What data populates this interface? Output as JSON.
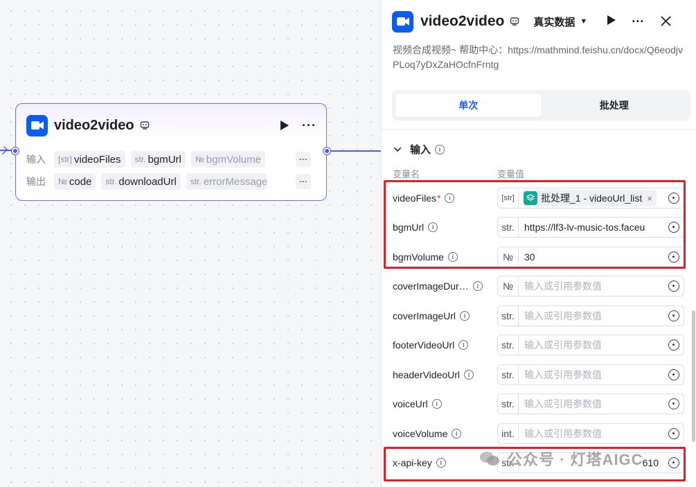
{
  "node": {
    "title": "video2video",
    "input_label": "输入",
    "output_label": "输出",
    "inputs": [
      {
        "type": "[str]",
        "name": "videoFiles"
      },
      {
        "type": "str.",
        "name": "bgmUrl"
      },
      {
        "type": "№",
        "name": "bgmVolume"
      }
    ],
    "outputs": [
      {
        "type": "№",
        "name": "code"
      },
      {
        "type": "str.",
        "name": "downloadUrl"
      },
      {
        "type": "str.",
        "name": "errorMessage"
      }
    ],
    "more": "···"
  },
  "panel": {
    "title": "video2video",
    "data_mode": "真实数据",
    "description": "视频合成视频~ 帮助中心：https://mathmind.feishu.cn/docx/Q6eodjvPLoq7yDxZaHOcfnFrntg",
    "tabs": [
      "单次",
      "批处理"
    ],
    "section_title": "输入",
    "col_name": "变量名",
    "col_value": "变量值",
    "params": [
      {
        "name": "videoFiles",
        "required": "*",
        "type": "[str]",
        "chip_text": "批处理_1 - videoUrl_list",
        "value": ""
      },
      {
        "name": "bgmUrl",
        "type": "str.",
        "value": "https://lf3-lv-music-tos.faceu"
      },
      {
        "name": "bgmVolume",
        "type": "№",
        "value": "30"
      },
      {
        "name": "coverImageDur…",
        "type": "№",
        "placeholder": "输入或引用参数值"
      },
      {
        "name": "coverImageUrl",
        "type": "str.",
        "placeholder": "输入或引用参数值"
      },
      {
        "name": "footerVideoUrl",
        "type": "str.",
        "placeholder": "输入或引用参数值"
      },
      {
        "name": "headerVideoUrl",
        "type": "str.",
        "placeholder": "输入或引用参数值"
      },
      {
        "name": "voiceUrl",
        "type": "str.",
        "placeholder": "输入或引用参数值"
      },
      {
        "name": "voiceVolume",
        "type": "int.",
        "placeholder": "输入或引用参数值"
      },
      {
        "name": "x-api-key",
        "type": "str.",
        "value": "610"
      }
    ]
  },
  "watermark": "公众号 · 灯塔AIGC",
  "colors": {
    "accent": "#1b5df3",
    "edge": "#4e5bf0",
    "highlight": "#e21e26",
    "chip": "#12a89a"
  }
}
